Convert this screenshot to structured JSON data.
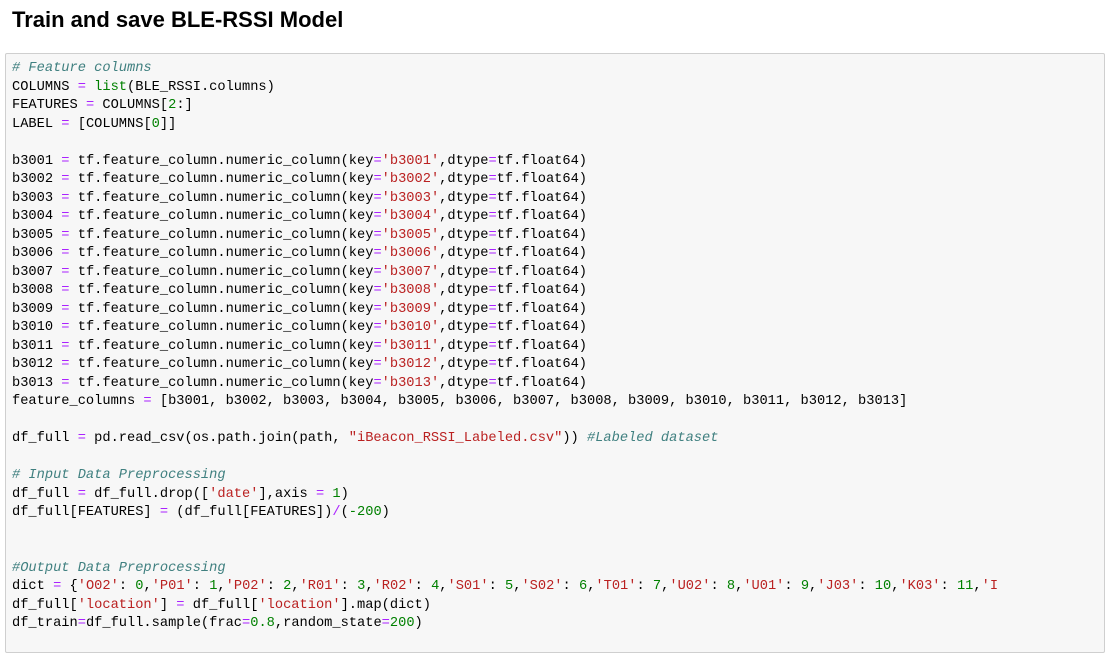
{
  "title": "Train and save BLE-RSSI Model",
  "code_lines": [
    [
      {
        "t": "# Feature columns",
        "c": "cm"
      }
    ],
    [
      {
        "t": "COLUMNS ",
        "c": ""
      },
      {
        "t": "=",
        "c": "o"
      },
      {
        "t": " ",
        "c": ""
      },
      {
        "t": "list",
        "c": "b"
      },
      {
        "t": "(BLE_RSSI.columns)",
        "c": ""
      }
    ],
    [
      {
        "t": "FEATURES ",
        "c": ""
      },
      {
        "t": "=",
        "c": "o"
      },
      {
        "t": " COLUMNS[",
        "c": ""
      },
      {
        "t": "2",
        "c": "n"
      },
      {
        "t": ":]",
        "c": ""
      }
    ],
    [
      {
        "t": "LABEL ",
        "c": ""
      },
      {
        "t": "=",
        "c": "o"
      },
      {
        "t": " [COLUMNS[",
        "c": ""
      },
      {
        "t": "0",
        "c": "n"
      },
      {
        "t": "]]",
        "c": ""
      }
    ],
    [],
    [
      {
        "t": "b3001 ",
        "c": ""
      },
      {
        "t": "=",
        "c": "o"
      },
      {
        "t": " tf.feature_column.numeric_column(key",
        "c": ""
      },
      {
        "t": "=",
        "c": "o"
      },
      {
        "t": "'b3001'",
        "c": "s"
      },
      {
        "t": ",dtype",
        "c": ""
      },
      {
        "t": "=",
        "c": "o"
      },
      {
        "t": "tf.float64)",
        "c": ""
      }
    ],
    [
      {
        "t": "b3002 ",
        "c": ""
      },
      {
        "t": "=",
        "c": "o"
      },
      {
        "t": " tf.feature_column.numeric_column(key",
        "c": ""
      },
      {
        "t": "=",
        "c": "o"
      },
      {
        "t": "'b3002'",
        "c": "s"
      },
      {
        "t": ",dtype",
        "c": ""
      },
      {
        "t": "=",
        "c": "o"
      },
      {
        "t": "tf.float64)",
        "c": ""
      }
    ],
    [
      {
        "t": "b3003 ",
        "c": ""
      },
      {
        "t": "=",
        "c": "o"
      },
      {
        "t": " tf.feature_column.numeric_column(key",
        "c": ""
      },
      {
        "t": "=",
        "c": "o"
      },
      {
        "t": "'b3003'",
        "c": "s"
      },
      {
        "t": ",dtype",
        "c": ""
      },
      {
        "t": "=",
        "c": "o"
      },
      {
        "t": "tf.float64)",
        "c": ""
      }
    ],
    [
      {
        "t": "b3004 ",
        "c": ""
      },
      {
        "t": "=",
        "c": "o"
      },
      {
        "t": " tf.feature_column.numeric_column(key",
        "c": ""
      },
      {
        "t": "=",
        "c": "o"
      },
      {
        "t": "'b3004'",
        "c": "s"
      },
      {
        "t": ",dtype",
        "c": ""
      },
      {
        "t": "=",
        "c": "o"
      },
      {
        "t": "tf.float64)",
        "c": ""
      }
    ],
    [
      {
        "t": "b3005 ",
        "c": ""
      },
      {
        "t": "=",
        "c": "o"
      },
      {
        "t": " tf.feature_column.numeric_column(key",
        "c": ""
      },
      {
        "t": "=",
        "c": "o"
      },
      {
        "t": "'b3005'",
        "c": "s"
      },
      {
        "t": ",dtype",
        "c": ""
      },
      {
        "t": "=",
        "c": "o"
      },
      {
        "t": "tf.float64)",
        "c": ""
      }
    ],
    [
      {
        "t": "b3006 ",
        "c": ""
      },
      {
        "t": "=",
        "c": "o"
      },
      {
        "t": " tf.feature_column.numeric_column(key",
        "c": ""
      },
      {
        "t": "=",
        "c": "o"
      },
      {
        "t": "'b3006'",
        "c": "s"
      },
      {
        "t": ",dtype",
        "c": ""
      },
      {
        "t": "=",
        "c": "o"
      },
      {
        "t": "tf.float64)",
        "c": ""
      }
    ],
    [
      {
        "t": "b3007 ",
        "c": ""
      },
      {
        "t": "=",
        "c": "o"
      },
      {
        "t": " tf.feature_column.numeric_column(key",
        "c": ""
      },
      {
        "t": "=",
        "c": "o"
      },
      {
        "t": "'b3007'",
        "c": "s"
      },
      {
        "t": ",dtype",
        "c": ""
      },
      {
        "t": "=",
        "c": "o"
      },
      {
        "t": "tf.float64)",
        "c": ""
      }
    ],
    [
      {
        "t": "b3008 ",
        "c": ""
      },
      {
        "t": "=",
        "c": "o"
      },
      {
        "t": " tf.feature_column.numeric_column(key",
        "c": ""
      },
      {
        "t": "=",
        "c": "o"
      },
      {
        "t": "'b3008'",
        "c": "s"
      },
      {
        "t": ",dtype",
        "c": ""
      },
      {
        "t": "=",
        "c": "o"
      },
      {
        "t": "tf.float64)",
        "c": ""
      }
    ],
    [
      {
        "t": "b3009 ",
        "c": ""
      },
      {
        "t": "=",
        "c": "o"
      },
      {
        "t": " tf.feature_column.numeric_column(key",
        "c": ""
      },
      {
        "t": "=",
        "c": "o"
      },
      {
        "t": "'b3009'",
        "c": "s"
      },
      {
        "t": ",dtype",
        "c": ""
      },
      {
        "t": "=",
        "c": "o"
      },
      {
        "t": "tf.float64)",
        "c": ""
      }
    ],
    [
      {
        "t": "b3010 ",
        "c": ""
      },
      {
        "t": "=",
        "c": "o"
      },
      {
        "t": " tf.feature_column.numeric_column(key",
        "c": ""
      },
      {
        "t": "=",
        "c": "o"
      },
      {
        "t": "'b3010'",
        "c": "s"
      },
      {
        "t": ",dtype",
        "c": ""
      },
      {
        "t": "=",
        "c": "o"
      },
      {
        "t": "tf.float64)",
        "c": ""
      }
    ],
    [
      {
        "t": "b3011 ",
        "c": ""
      },
      {
        "t": "=",
        "c": "o"
      },
      {
        "t": " tf.feature_column.numeric_column(key",
        "c": ""
      },
      {
        "t": "=",
        "c": "o"
      },
      {
        "t": "'b3011'",
        "c": "s"
      },
      {
        "t": ",dtype",
        "c": ""
      },
      {
        "t": "=",
        "c": "o"
      },
      {
        "t": "tf.float64)",
        "c": ""
      }
    ],
    [
      {
        "t": "b3012 ",
        "c": ""
      },
      {
        "t": "=",
        "c": "o"
      },
      {
        "t": " tf.feature_column.numeric_column(key",
        "c": ""
      },
      {
        "t": "=",
        "c": "o"
      },
      {
        "t": "'b3012'",
        "c": "s"
      },
      {
        "t": ",dtype",
        "c": ""
      },
      {
        "t": "=",
        "c": "o"
      },
      {
        "t": "tf.float64)",
        "c": ""
      }
    ],
    [
      {
        "t": "b3013 ",
        "c": ""
      },
      {
        "t": "=",
        "c": "o"
      },
      {
        "t": " tf.feature_column.numeric_column(key",
        "c": ""
      },
      {
        "t": "=",
        "c": "o"
      },
      {
        "t": "'b3013'",
        "c": "s"
      },
      {
        "t": ",dtype",
        "c": ""
      },
      {
        "t": "=",
        "c": "o"
      },
      {
        "t": "tf.float64)",
        "c": ""
      }
    ],
    [
      {
        "t": "feature_columns ",
        "c": ""
      },
      {
        "t": "=",
        "c": "o"
      },
      {
        "t": " [b3001, b3002, b3003, b3004, b3005, b3006, b3007, b3008, b3009, b3010, b3011, b3012, b3013]",
        "c": ""
      }
    ],
    [],
    [
      {
        "t": "df_full ",
        "c": ""
      },
      {
        "t": "=",
        "c": "o"
      },
      {
        "t": " pd.read_csv(os.path.join(path, ",
        "c": ""
      },
      {
        "t": "\"iBeacon_RSSI_Labeled.csv\"",
        "c": "s"
      },
      {
        "t": ")) ",
        "c": ""
      },
      {
        "t": "#Labeled dataset",
        "c": "cm"
      }
    ],
    [],
    [
      {
        "t": "# Input Data Preprocessing",
        "c": "cm"
      }
    ],
    [
      {
        "t": "df_full ",
        "c": ""
      },
      {
        "t": "=",
        "c": "o"
      },
      {
        "t": " df_full.drop([",
        "c": ""
      },
      {
        "t": "'date'",
        "c": "s"
      },
      {
        "t": "],axis ",
        "c": ""
      },
      {
        "t": "=",
        "c": "o"
      },
      {
        "t": " ",
        "c": ""
      },
      {
        "t": "1",
        "c": "n"
      },
      {
        "t": ")",
        "c": ""
      }
    ],
    [
      {
        "t": "df_full[FEATURES] ",
        "c": ""
      },
      {
        "t": "=",
        "c": "o"
      },
      {
        "t": " (df_full[FEATURES])",
        "c": ""
      },
      {
        "t": "/",
        "c": "o"
      },
      {
        "t": "(",
        "c": ""
      },
      {
        "t": "-200",
        "c": "n"
      },
      {
        "t": ")",
        "c": ""
      }
    ],
    [],
    [],
    [
      {
        "t": "#Output Data Preprocessing",
        "c": "cm"
      }
    ],
    [
      {
        "t": "dict ",
        "c": ""
      },
      {
        "t": "=",
        "c": "o"
      },
      {
        "t": " {",
        "c": ""
      },
      {
        "t": "'O02'",
        "c": "s"
      },
      {
        "t": ": ",
        "c": ""
      },
      {
        "t": "0",
        "c": "n"
      },
      {
        "t": ",",
        "c": ""
      },
      {
        "t": "'P01'",
        "c": "s"
      },
      {
        "t": ": ",
        "c": ""
      },
      {
        "t": "1",
        "c": "n"
      },
      {
        "t": ",",
        "c": ""
      },
      {
        "t": "'P02'",
        "c": "s"
      },
      {
        "t": ": ",
        "c": ""
      },
      {
        "t": "2",
        "c": "n"
      },
      {
        "t": ",",
        "c": ""
      },
      {
        "t": "'R01'",
        "c": "s"
      },
      {
        "t": ": ",
        "c": ""
      },
      {
        "t": "3",
        "c": "n"
      },
      {
        "t": ",",
        "c": ""
      },
      {
        "t": "'R02'",
        "c": "s"
      },
      {
        "t": ": ",
        "c": ""
      },
      {
        "t": "4",
        "c": "n"
      },
      {
        "t": ",",
        "c": ""
      },
      {
        "t": "'S01'",
        "c": "s"
      },
      {
        "t": ": ",
        "c": ""
      },
      {
        "t": "5",
        "c": "n"
      },
      {
        "t": ",",
        "c": ""
      },
      {
        "t": "'S02'",
        "c": "s"
      },
      {
        "t": ": ",
        "c": ""
      },
      {
        "t": "6",
        "c": "n"
      },
      {
        "t": ",",
        "c": ""
      },
      {
        "t": "'T01'",
        "c": "s"
      },
      {
        "t": ": ",
        "c": ""
      },
      {
        "t": "7",
        "c": "n"
      },
      {
        "t": ",",
        "c": ""
      },
      {
        "t": "'U02'",
        "c": "s"
      },
      {
        "t": ": ",
        "c": ""
      },
      {
        "t": "8",
        "c": "n"
      },
      {
        "t": ",",
        "c": ""
      },
      {
        "t": "'U01'",
        "c": "s"
      },
      {
        "t": ": ",
        "c": ""
      },
      {
        "t": "9",
        "c": "n"
      },
      {
        "t": ",",
        "c": ""
      },
      {
        "t": "'J03'",
        "c": "s"
      },
      {
        "t": ": ",
        "c": ""
      },
      {
        "t": "10",
        "c": "n"
      },
      {
        "t": ",",
        "c": ""
      },
      {
        "t": "'K03'",
        "c": "s"
      },
      {
        "t": ": ",
        "c": ""
      },
      {
        "t": "11",
        "c": "n"
      },
      {
        "t": ",",
        "c": ""
      },
      {
        "t": "'I",
        "c": "s"
      }
    ],
    [
      {
        "t": "df_full[",
        "c": ""
      },
      {
        "t": "'location'",
        "c": "s"
      },
      {
        "t": "] ",
        "c": ""
      },
      {
        "t": "=",
        "c": "o"
      },
      {
        "t": " df_full[",
        "c": ""
      },
      {
        "t": "'location'",
        "c": "s"
      },
      {
        "t": "].map(dict)",
        "c": ""
      }
    ],
    [
      {
        "t": "df_train",
        "c": ""
      },
      {
        "t": "=",
        "c": "o"
      },
      {
        "t": "df_full.sample(frac",
        "c": ""
      },
      {
        "t": "=",
        "c": "o"
      },
      {
        "t": "0.8",
        "c": "n"
      },
      {
        "t": ",random_state",
        "c": ""
      },
      {
        "t": "=",
        "c": "o"
      },
      {
        "t": "200",
        "c": "n"
      },
      {
        "t": ")",
        "c": ""
      }
    ]
  ]
}
